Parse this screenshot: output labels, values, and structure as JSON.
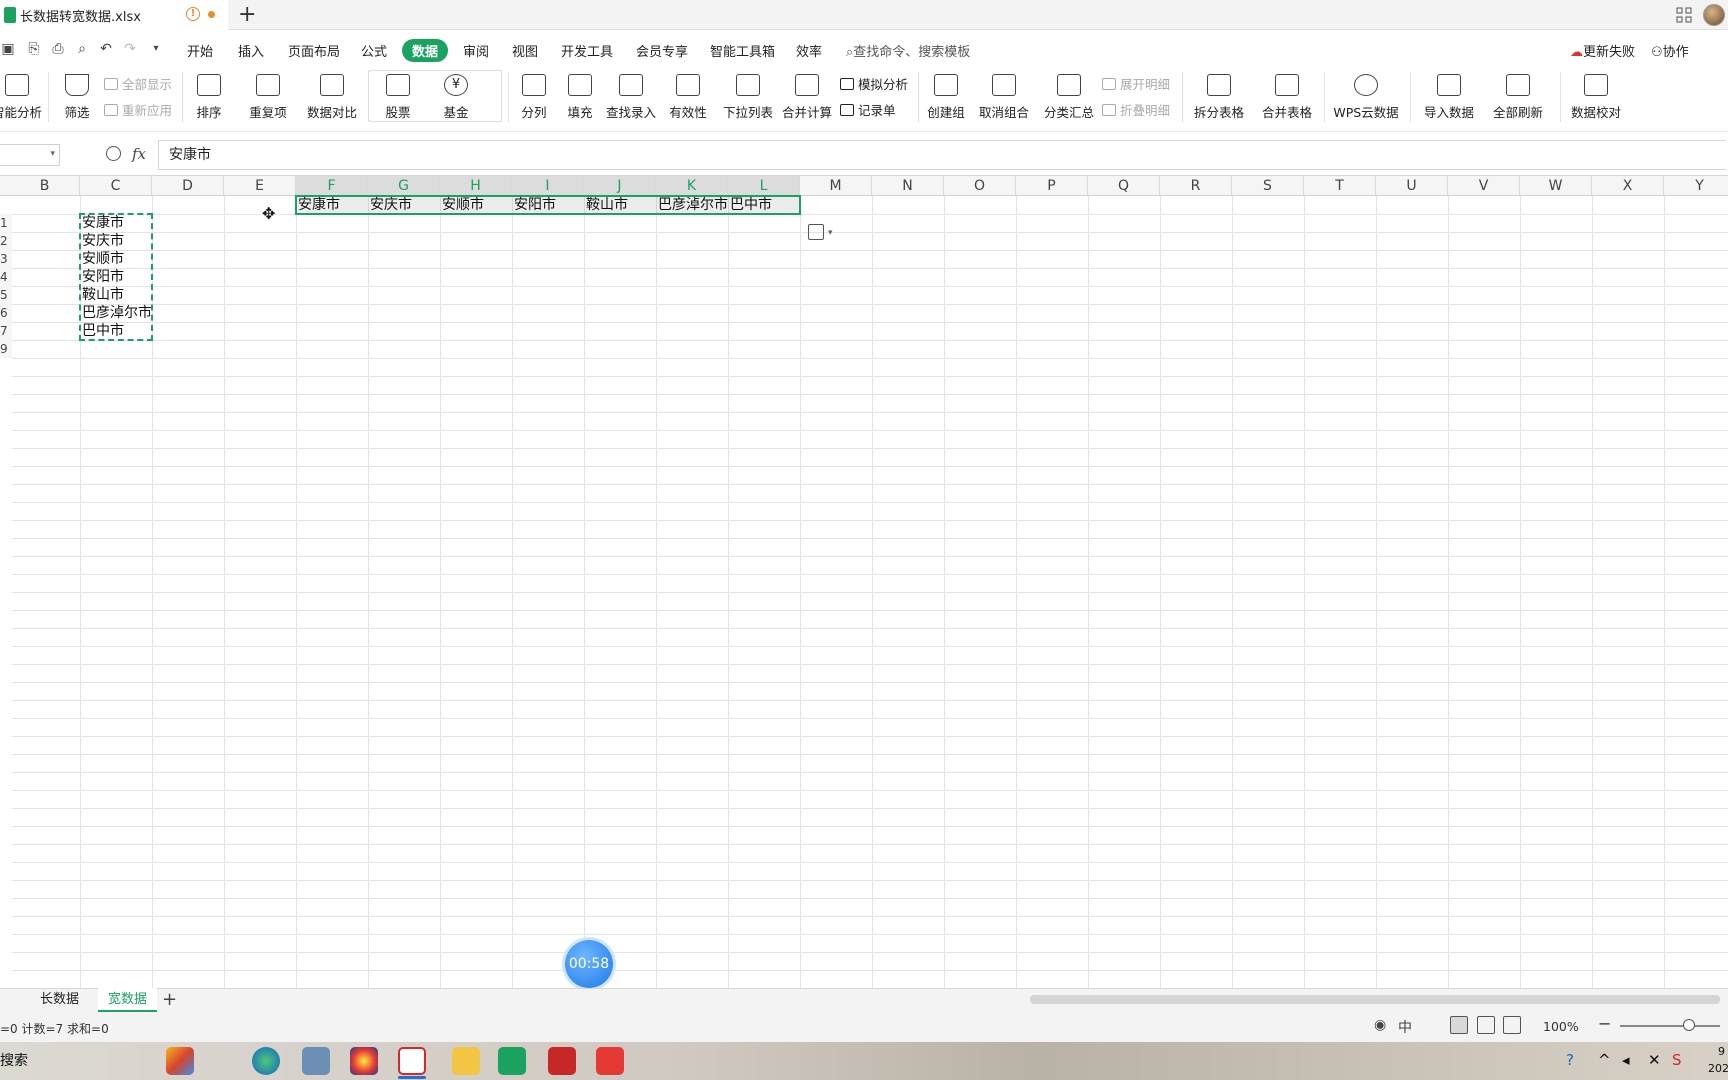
{
  "titlebar": {
    "doc_title": "长数据转宽数据.xlsx",
    "warn_glyph": "!",
    "new_tab": "+"
  },
  "menu": {
    "items": [
      "开始",
      "插入",
      "页面布局",
      "公式",
      "数据",
      "审阅",
      "视图",
      "开发工具",
      "会员专享",
      "智能工具箱",
      "效率"
    ],
    "active": "数据",
    "search_placeholder": "查找命令、搜索模板",
    "update_fail": "更新失败",
    "collab": "协作"
  },
  "ribbon": {
    "smart_analysis": "智能分析",
    "filter": "筛选",
    "show_all": "全部显示",
    "reapply": "重新应用",
    "sort": "排序",
    "duplicates": "重复项",
    "compare": "数据对比",
    "stock": "股票",
    "fund": "基金",
    "fund_glyph": "¥",
    "split_col": "分列",
    "fill": "填充",
    "lookup_entry": "查找录入",
    "validity": "有效性",
    "dropdown_list": "下拉列表",
    "consolidate": "合并计算",
    "what_if": "模拟分析",
    "record_form": "记录单",
    "group": "创建组",
    "ungroup": "取消组合",
    "subtotal": "分类汇总",
    "expand_detail": "展开明细",
    "collapse_detail": "折叠明细",
    "split_table": "拆分表格",
    "merge_table": "合并表格",
    "wps_cloud": "WPS云数据",
    "import": "导入数据",
    "refresh_all": "全部刷新",
    "data_check": "数据校对"
  },
  "formula": {
    "fx": "fx",
    "value": "安康市"
  },
  "grid": {
    "columns": [
      "B",
      "C",
      "D",
      "E",
      "F",
      "G",
      "H",
      "I",
      "J",
      "K",
      "L",
      "M",
      "N",
      "O",
      "P",
      "Q",
      "R",
      "S",
      "T",
      "U",
      "V",
      "W",
      "X",
      "Y"
    ],
    "selected_columns": [
      "F",
      "G",
      "H",
      "I",
      "J",
      "K",
      "L"
    ],
    "row_numbers": [
      "1",
      "2",
      "3",
      "4",
      "5",
      "6",
      "7",
      "9"
    ],
    "column_c_values": [
      "安康市",
      "安庆市",
      "安顺市",
      "安阳市",
      "鞍山市",
      "巴彦淖尔市",
      "巴中市"
    ],
    "transposed_row": [
      "安康市",
      "安庆市",
      "安顺市",
      "安阳市",
      "鞍山市",
      "巴彦淖尔市",
      "巴中市"
    ],
    "cursor_glyph": "✥"
  },
  "timer": "00:58",
  "sheets": {
    "tabs": [
      "长数据",
      "宽数据"
    ],
    "active": "宽数据",
    "add": "+"
  },
  "status": {
    "text": "=0  计数=7  求和=0",
    "zoom": "100%",
    "zoom_minus": "−",
    "ime": "中"
  },
  "taskbar": {
    "search_label": "搜索",
    "clock_a": "9",
    "clock_b": "202"
  },
  "colors": {
    "accent": "#1aa260",
    "warning": "#e88c2c"
  }
}
